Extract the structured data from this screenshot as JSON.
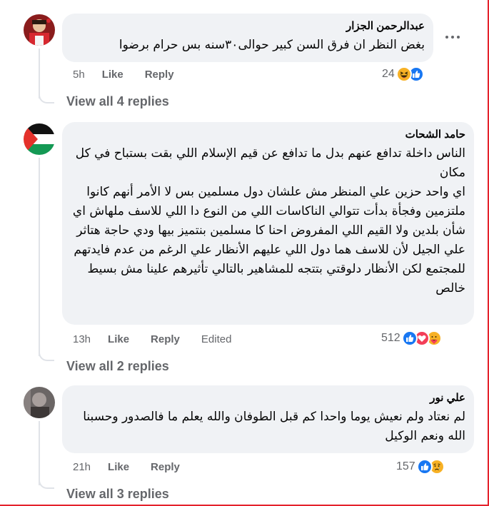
{
  "comments": [
    {
      "author": "عبدالرحمن الجزار",
      "text": "بغض النظر ان فرق السن كبير حوالى٣٠سنه بس حرام برضوا",
      "time": "5h",
      "like": "Like",
      "reply": "Reply",
      "reaction_count": "24",
      "reactions": [
        "haha",
        "like"
      ],
      "view_replies": "View all 4 replies"
    },
    {
      "author": "حامد الشحات",
      "text": "الناس داخلة تدافع عنهم بدل ما تدافع عن قيم الإسلام اللي بقت بستباح في كل مكان\nاي واحد حزين علي المنظر مش علشان دول مسلمين بس لا الأمر أنهم كانوا ملتزمين وفجأة بدأت تتوالي الناكاسات اللي من النوع دا اللي للاسف ملهاش اي شأن بلدين ولا القيم اللي المفروض احنا كا مسلمين بنتميز بيها ودي حاجة هتاثر علي الجيل لأن للاسف هما دول اللي عليهم الأنظار علي الرغم من عدم فايدتهم للمجتمع لكن الأنظار دلوقتي بتتجه للمشاهير بالتالي تأثيرهم علينا مش بسيط خالص",
      "time": "13h",
      "like": "Like",
      "reply": "Reply",
      "edited": "Edited",
      "reaction_count": "512",
      "reactions": [
        "like",
        "love",
        "care"
      ],
      "view_replies": "View all 2 replies"
    },
    {
      "author": "علي نور",
      "text": "لم نعتاد ولم نعيش يوما واحدا كم قبل الطوفان والله يعلم ما فالصدور وحسبنا الله ونعم الوكيل",
      "time": "21h",
      "like": "Like",
      "reply": "Reply",
      "reaction_count": "157",
      "reactions": [
        "like",
        "sad"
      ],
      "view_replies": "View all 3 replies"
    }
  ],
  "colors": {
    "bubble": "#f0f2f5",
    "meta_text": "#65676b",
    "like_blue": "#1877f2",
    "love_red": "#f33e58",
    "emoji_yellow": "#f7b125",
    "frame_red": "#e4212b"
  }
}
